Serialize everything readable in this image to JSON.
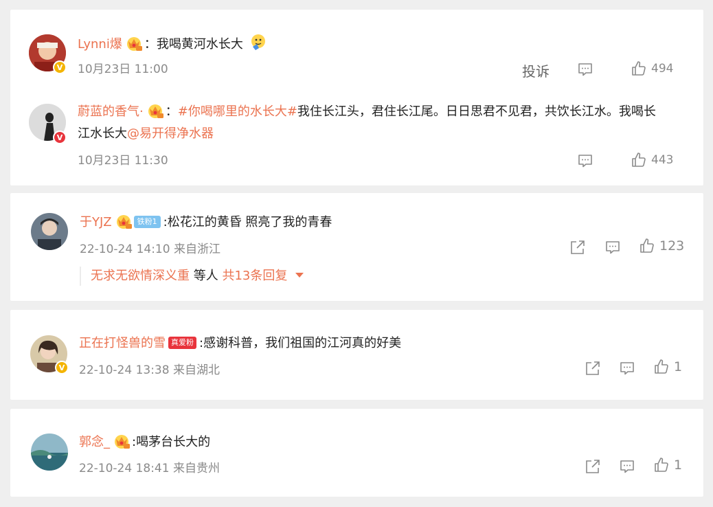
{
  "comments": [
    {
      "user": "Lynni爆",
      "sep": "：",
      "text": "我喝黄河水长大",
      "time": "10月23日 11:00",
      "report_label": "投诉",
      "likes": "494",
      "reply": {
        "user": "蔚蓝的香气·",
        "sep": "：",
        "topic": "#你喝哪里的水长大#",
        "text_line1": "我住长江头，君住长江尾。日日思君不见君，共饮长江水。我喝长",
        "text_line2": "江水长大",
        "mention": "@易开得净水器",
        "time": "10月23日 11:30",
        "likes": "443"
      }
    },
    {
      "user": "于YJZ",
      "fan_badge": "铁粉1",
      "text": ":松花江的黄昏 照亮了我的青春",
      "time": "22-10-24 14:10 来自浙江",
      "likes": "123",
      "replies_user": "无求无欲情深义重",
      "replies_mid": " 等人 ",
      "replies_count": "共13条回复"
    },
    {
      "user": "正在打怪兽的雪",
      "true_badge": "真爱粉",
      "text": ":感谢科普，我们祖国的江河真的好美",
      "time": "22-10-24 13:38 来自湖北",
      "likes": "1"
    },
    {
      "user": "郭念_",
      "text": ":喝茅台长大的",
      "time": "22-10-24 18:41 来自贵州",
      "likes": "1"
    }
  ],
  "colors": {
    "accent": "#eb7350",
    "meta": "#8a8a8a",
    "verified_gold": "#f4b400",
    "verified_red": "#e8343c"
  }
}
